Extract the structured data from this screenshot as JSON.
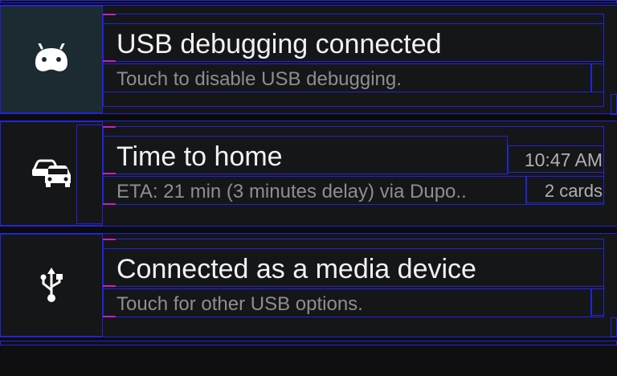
{
  "notifications": [
    {
      "icon": "android-icon",
      "title": "USB debugging connected",
      "subtitle": "Touch to disable USB debugging."
    },
    {
      "icon": "traffic-cars-icon",
      "title": "Time to home",
      "subtitle": "ETA: 21 min (3 minutes delay) via Dupo..",
      "time": "10:47 AM",
      "count": "2 cards"
    },
    {
      "icon": "usb-icon",
      "title": "Connected as a media device",
      "subtitle": "Touch for other USB options."
    }
  ],
  "colors": {
    "debug_outline": "#2323d8",
    "debug_accent": "#c81ec8",
    "card_bg": "#151618",
    "highlight_icon_bg": "#1b2b31"
  }
}
